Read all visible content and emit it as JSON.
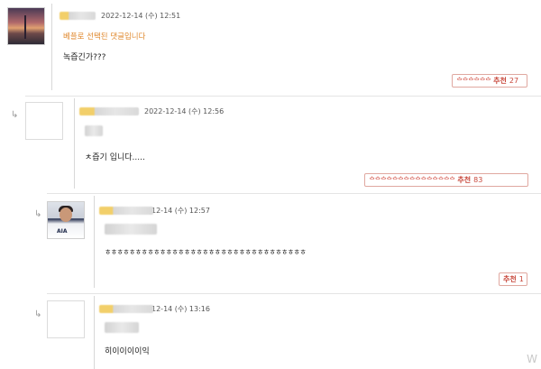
{
  "comments": [
    {
      "date": "2022-12-14 (수) 12:51",
      "best_label": "베플로 선택된 댓글입니다",
      "text": "녹즙긴가???",
      "vote": {
        "thumbs": "ᅌᅌᅌᅌᅌᅌ",
        "label": "추천",
        "count": "27"
      },
      "avatar": "sunset-bridge-avatar"
    },
    {
      "date": "2022-12-14 (수) 12:56",
      "text": "ㅊ즙기 입니다.....",
      "vote": {
        "thumbs": "ᅌᅌᅌᅌᅌᅌᅌᅌᅌᅌᅌᅌᅌᅌᅌ",
        "label": "추천",
        "count": "83"
      },
      "avatar": "empty-avatar"
    },
    {
      "date": "12-14 (수) 12:57",
      "text": "ㅎㅎㅎㅎㅎㅎㅎㅎㅎㅎㅎㅎㅎㅎㅎㅎㅎㅎㅎㅎㅎㅎㅎㅎㅎㅎㅎㅎㅎㅎㅎㅎㅎ",
      "vote": {
        "label": "추천",
        "count": "1"
      },
      "avatar": "player-avatar",
      "avatar_text": "AIA"
    },
    {
      "date": "12-14 (수) 13:16",
      "text": "히이이이이익",
      "avatar": "empty-avatar"
    }
  ],
  "reply_arrow": "↳",
  "watermark": "W",
  "colors": {
    "best_label": "#e08a30",
    "vote_text": "#c8473b",
    "vote_border": "#e0a8a0",
    "divider": "#e4e4e4"
  }
}
